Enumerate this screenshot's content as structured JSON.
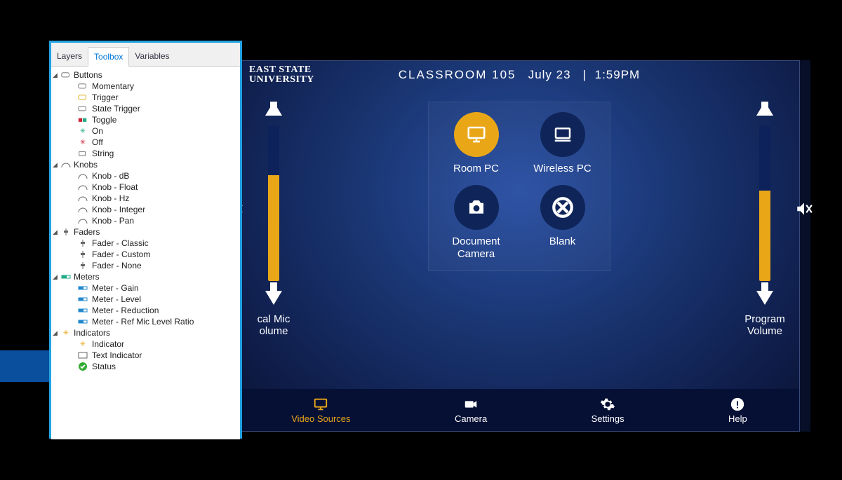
{
  "toolbox": {
    "tabs": [
      "Layers",
      "Toolbox",
      "Variables"
    ],
    "active_tab": "Toolbox",
    "groups": [
      {
        "name": "Buttons",
        "items": [
          "Momentary",
          "Trigger",
          "State Trigger",
          "Toggle",
          "On",
          "Off",
          "String"
        ]
      },
      {
        "name": "Knobs",
        "items": [
          "Knob - dB",
          "Knob - Float",
          "Knob - Hz",
          "Knob - Integer",
          "Knob - Pan"
        ]
      },
      {
        "name": "Faders",
        "items": [
          "Fader - Classic",
          "Fader - Custom",
          "Fader - None"
        ]
      },
      {
        "name": "Meters",
        "items": [
          "Meter - Gain",
          "Meter - Level",
          "Meter - Reduction",
          "Meter - Ref Mic Level Ratio"
        ]
      },
      {
        "name": "Indicators",
        "items": [
          "Indicator",
          "Text Indicator",
          "Status"
        ]
      }
    ]
  },
  "panel": {
    "university_line1": "EAST STATE",
    "university_line2": "UNIVERSITY",
    "room": "CLASSROOM 105",
    "date": "July 23",
    "time": "1:59PM",
    "left_slider": {
      "label_line1": "cal Mic",
      "label_line2": "olume",
      "fill_pct": 68
    },
    "right_slider": {
      "label_line1": "Program",
      "label_line2": "Volume",
      "fill_pct": 58
    },
    "sources": [
      {
        "id": "room-pc",
        "label": "Room PC",
        "active": true
      },
      {
        "id": "wireless-pc",
        "label": "Wireless PC",
        "active": false
      },
      {
        "id": "doc-cam",
        "label": "Document Camera",
        "active": false
      },
      {
        "id": "blank",
        "label": "Blank",
        "active": false
      }
    ],
    "nav": [
      {
        "id": "video-sources",
        "label": "Video Sources",
        "active": true
      },
      {
        "id": "camera",
        "label": "Camera",
        "active": false
      },
      {
        "id": "settings",
        "label": "Settings",
        "active": false
      },
      {
        "id": "help",
        "label": "Help",
        "active": false
      }
    ]
  },
  "colors": {
    "accent": "#e9a718"
  }
}
